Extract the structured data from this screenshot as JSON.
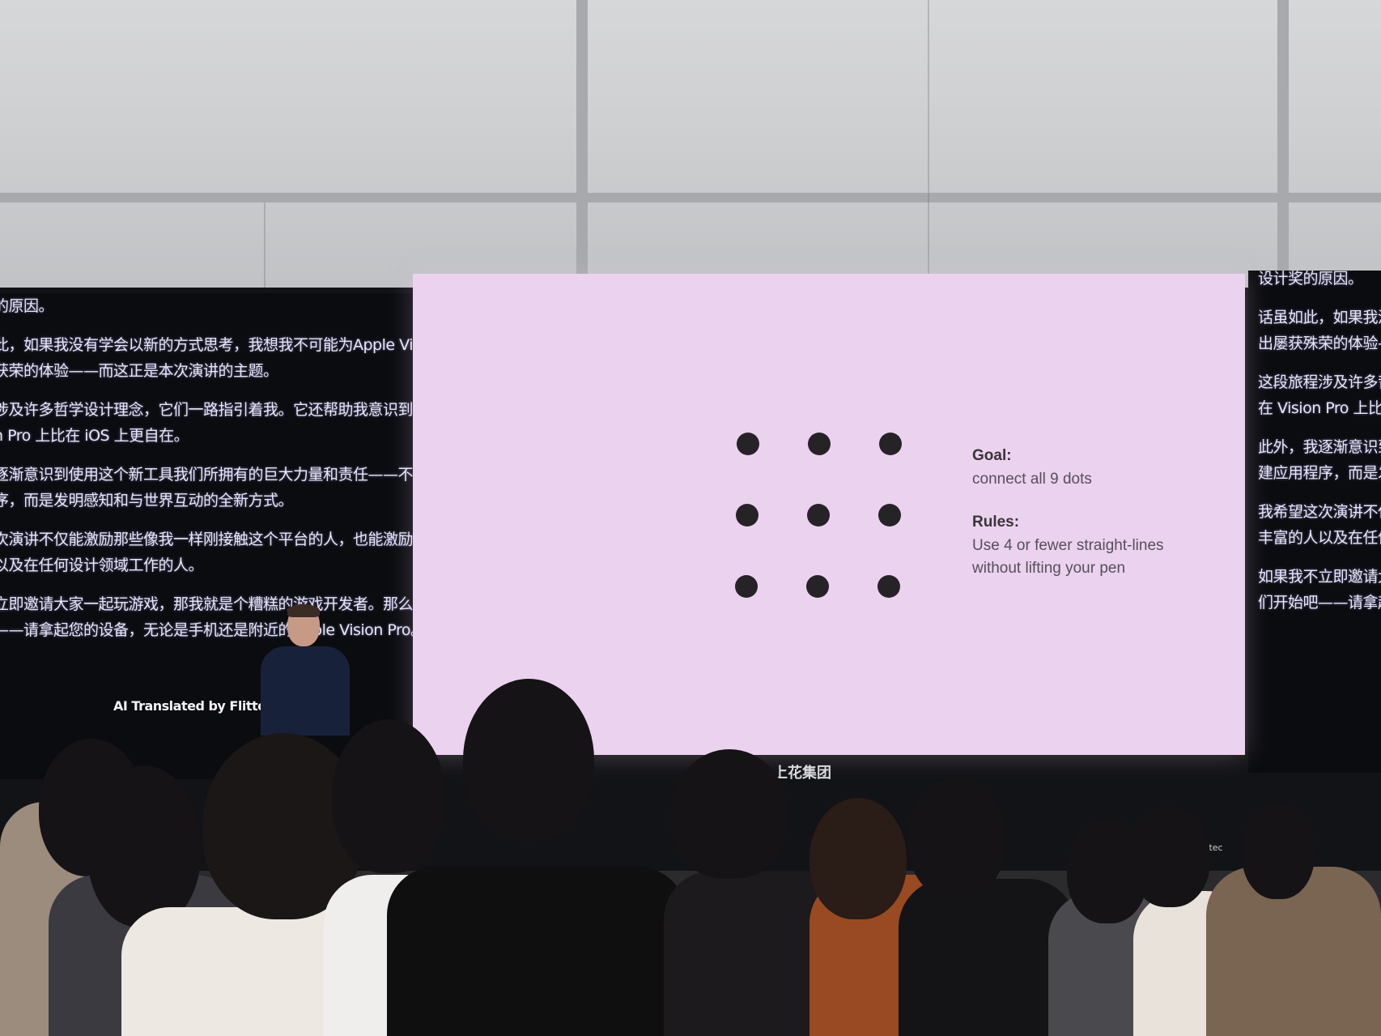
{
  "slide": {
    "goal_title": "Goal:",
    "goal_text": "connect all 9 dots",
    "rules_title": "Rules:",
    "rules_line1": "Use 4 or fewer straight-lines",
    "rules_line2": "without lifting your pen",
    "dots": 9
  },
  "left_captions": [
    "的原因。",
    "此，如果我没有学会以新的方式思考，我想我不可能为Apple Vision Pro 设计",
    "获荣的体验——而这正是本次演讲的主题。",
    "涉及许多哲学设计理念，它们一路指引着我。它还帮助我意识到 Blackbox",
    "n Pro 上比在 iOS 上更自在。",
    "逐渐意识到使用这个新工具我们所拥有的巨大力量和责任——不仅仅是创",
    "序，而是发明感知和与世界互动的全新方式。",
    "次演讲不仅能激励那些像我一样刚接触这个平台的人，也能激励那些经验",
    "以及在任何设计领域工作的人。",
    "立即邀请大家一起玩游戏，那我就是个糟糕的游戏开发者。那么，让我",
    "——请拿起您的设备，无论是手机还是附近的Apple Vision Pro。"
  ],
  "credit": "AI Translated by Flitto",
  "right_captions": [
    "设计奖的原因。",
    "话虽如此，如果我没",
    "出屡获殊荣的体验—",
    "这段旅程涉及许多哲",
    "在 Vision Pro 上比在",
    "此外，我逐渐意识到",
    "建应用程序，而是发",
    "我希望这次演讲不仅",
    "丰富的人以及在任何",
    "如果我不立即邀请大",
    "们开始吧——请拿起"
  ],
  "sponsor_logo": "上花集团",
  "sponsor_small": "omtec"
}
